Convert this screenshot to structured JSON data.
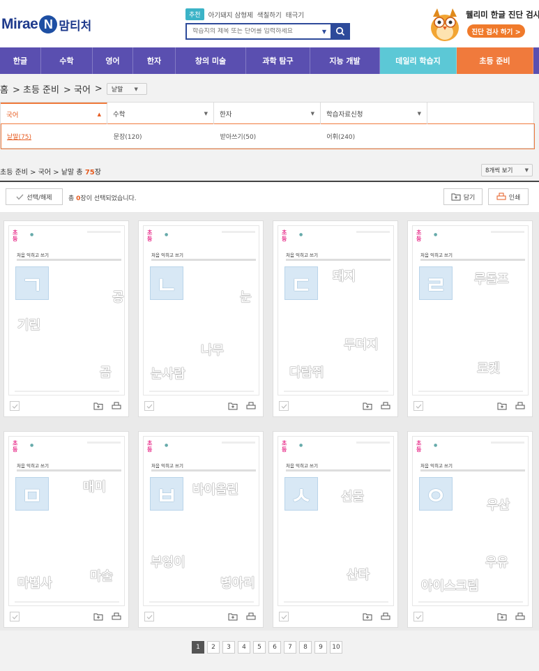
{
  "header": {
    "logo_text": "Mirae",
    "logo_letter": "N",
    "logo_sub": "맘티처",
    "recommend_badge": "추천",
    "recommend_keywords": [
      "아기돼지 삼형제",
      "색칠하기",
      "태극기"
    ],
    "search_placeholder": "학습지의 제목 또는 단어를 입력하세요",
    "diagnosis_title": "웰리미 한글 진단 검사",
    "diagnosis_button": "진단 검사 하기 >"
  },
  "nav": {
    "items": [
      "한글",
      "수학",
      "영어",
      "한자",
      "창의 미술",
      "과학 탐구",
      "지능 개발",
      "데일리 학습지",
      "초등 준비"
    ]
  },
  "breadcrumb": {
    "home": "홈",
    "level1": "> 초등 준비",
    "level2": "> 국어",
    "sep": ">",
    "select_value": "낱말"
  },
  "filter": {
    "headers": [
      "국어",
      "수학",
      "한자",
      "학습자료신청",
      ""
    ],
    "row": [
      "낱말(75)",
      "문장(120)",
      "받아쓰기(50)",
      "어휘(240)",
      ""
    ]
  },
  "results": {
    "path": "초등 준비 > 국어 > 낱말 총",
    "count": "75",
    "unit": "장",
    "view_select": "8개씩 보기",
    "select_toggle": "선택/해제",
    "selected_prefix": "총",
    "selected_count": "0",
    "selected_suffix": "장이 선택되었습니다.",
    "save_label": "담기",
    "print_label": "인쇄"
  },
  "worksheet_title": "처음 익히고 쓰기",
  "cards": [
    {
      "jamo": "ㄱ",
      "words": [
        "공",
        "기린",
        "곰"
      ]
    },
    {
      "jamo": "ㄴ",
      "words": [
        "눈",
        "나무",
        "눈사람"
      ]
    },
    {
      "jamo": "ㄷ",
      "words": [
        "돼지",
        "두더지",
        "다람쥐"
      ]
    },
    {
      "jamo": "ㄹ",
      "words": [
        "루돌프",
        "로켓"
      ]
    },
    {
      "jamo": "ㅁ",
      "words": [
        "매미",
        "마술",
        "마법사"
      ]
    },
    {
      "jamo": "ㅂ",
      "words": [
        "바이올린",
        "부엉이",
        "병아리"
      ]
    },
    {
      "jamo": "ㅅ",
      "words": [
        "선물",
        "산타"
      ]
    },
    {
      "jamo": "ㅇ",
      "words": [
        "우산",
        "우유",
        "아이스크림"
      ]
    }
  ],
  "pagination": [
    "1",
    "2",
    "3",
    "4",
    "5",
    "6",
    "7",
    "8",
    "9",
    "10"
  ],
  "colors": {
    "nav_bg": "#5a4fb0",
    "daily_bg": "#5cc8d6",
    "prep_bg": "#f07a3c",
    "accent": "#e65a1e",
    "search_border": "#2d4a9a"
  }
}
